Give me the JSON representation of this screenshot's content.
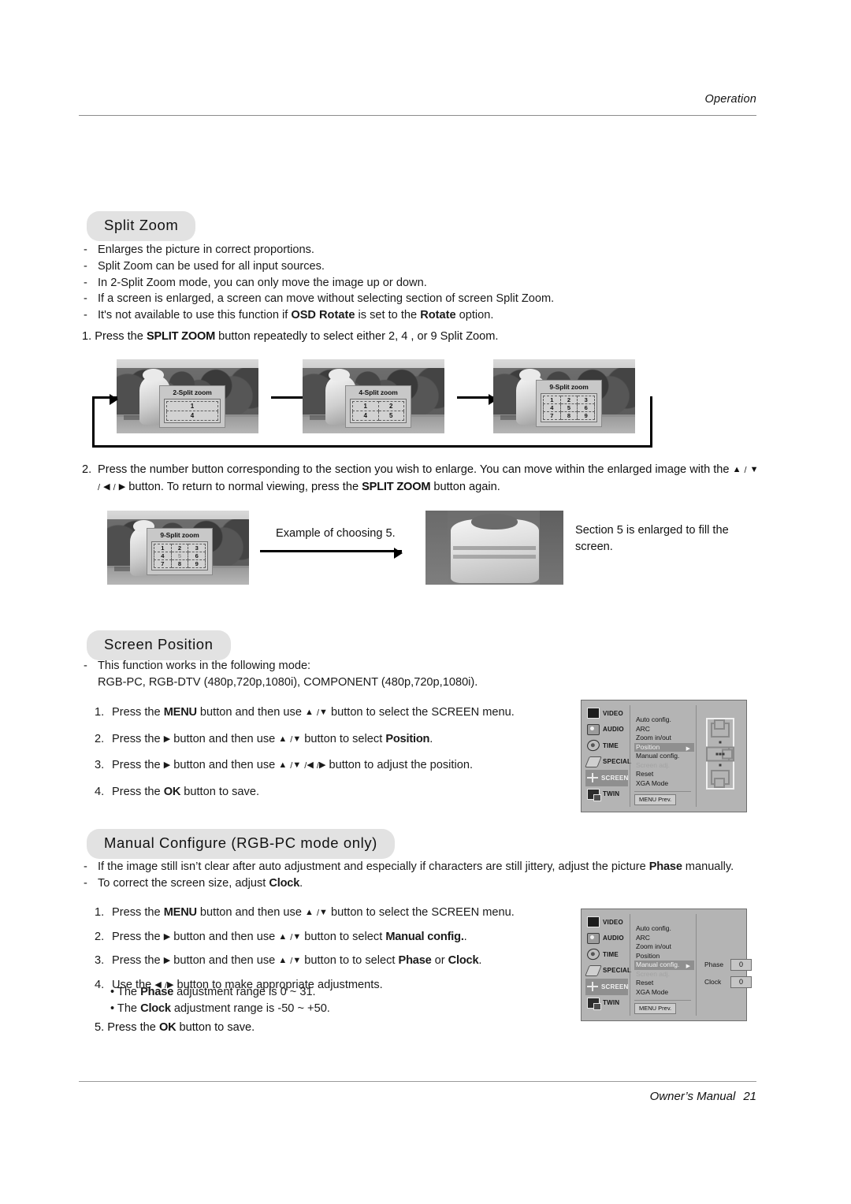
{
  "header": {
    "running_head": "Operation"
  },
  "footer": {
    "manual_label": "Owner’s Manual",
    "page_number": "21"
  },
  "split_zoom": {
    "title": "Split Zoom",
    "bullets": [
      "Enlarges the picture in correct proportions.",
      "Split Zoom can be used for all input sources.",
      "In 2-Split Zoom mode, you can only move the image up or down.",
      "If a screen is enlarged, a screen can move without selecting section of screen Split Zoom.",
      "It’s not available to use this function if OSD Rotate is set to the Rotate option."
    ],
    "step1_num": "1.",
    "step1_a": "Press the ",
    "step1_b": "SPLIT ZOOM",
    "step1_c": " button repeatedly to select either 2, 4 , or 9 Split Zoom.",
    "step2_num": "2.",
    "step2_a": "Press the number button corresponding to the section you wish to enlarge. You can move within the enlarged image with the ",
    "step2_b": " button. To return to normal viewing, press the ",
    "step2_c": "SPLIT ZOOM",
    "step2_d": " button again.",
    "osd_2split_title": "2-Split zoom",
    "osd_2split_cells": [
      "1",
      "4"
    ],
    "osd_4split_title": "4-Split zoom",
    "osd_4split_cells": [
      "1",
      "2",
      "4",
      "5"
    ],
    "osd_9split_title": "9-Split zoom",
    "osd_9split_cells": [
      "1",
      "2",
      "3",
      "4",
      "5",
      "6",
      "7",
      "8",
      "9"
    ],
    "example_caption": "Example of choosing 5.",
    "result_caption": "Section 5 is enlarged to fill the screen."
  },
  "screen_position": {
    "title": "Screen Position",
    "note_line1": "This function works in the following mode:",
    "note_line2": "RGB-PC, RGB-DTV (480p,720p,1080i), COMPONENT (480p,720p,1080i).",
    "steps": [
      {
        "num": "1.",
        "a": "Press the ",
        "b1": "MENU",
        "c": " button and then use ",
        "arrows": "▲ / ▼",
        "d": " button to select the SCREEN menu.",
        "b2": "",
        "e": ""
      },
      {
        "num": "2.",
        "a": "Press the ▶ button and then use ",
        "arrows": "▲ / ▼",
        "d": " button to select ",
        "b2": "Position",
        "e": "."
      },
      {
        "num": "3.",
        "a": "Press the ▶ button and then use ",
        "arrows": "▲ / ▼ / ◀ / ▶",
        "d": " button to adjust the position.",
        "b2": "",
        "e": ""
      },
      {
        "num": "4.",
        "a": "Press the ",
        "b1": "OK",
        "c": " button to save.",
        "arrows": "",
        "d": "",
        "b2": "",
        "e": ""
      }
    ]
  },
  "manual_configure": {
    "title": "Manual Configure (RGB-PC mode only)",
    "note1_a": "If the image still isn’t clear after auto adjustment and especially if characters are still jittery, adjust the picture ",
    "note1_b": "Phase",
    "note1_c": " manually.",
    "note2_a": "To correct the screen size, adjust ",
    "note2_b": "Clock",
    "note2_c": ".",
    "steps": [
      {
        "num": "1.",
        "a": "Press the ",
        "b1": "MENU",
        "c": " button and then use ",
        "arrows": "▲ / ▼",
        "d": " button to select the SCREEN menu."
      },
      {
        "num": "2.",
        "a": "Press the ▶ button and then use ",
        "arrows": "▲ / ▼",
        "d": " button to select ",
        "b2": "Manual config.",
        "e": "."
      },
      {
        "num": "3.",
        "a": "Press the ▶ button and then use ",
        "arrows": "▲ / ▼",
        "d": " button to to select ",
        "b2": "Phase",
        "e": " or ",
        "b3": "Clock",
        "f": "."
      },
      {
        "num": "4.",
        "a": "Use the ",
        "arrows": "◀ / ▶",
        "d": " button to make appropriate adjustments."
      },
      {
        "num": "5.",
        "a": "Press the ",
        "b1": "OK",
        "c": " button to save."
      }
    ],
    "bullet1_a": "• The ",
    "bullet1_b": "Phase",
    "bullet1_c": " adjustment range is 0 ~ 31.",
    "bullet2_a": "• The ",
    "bullet2_b": "Clock",
    "bullet2_c": " adjustment range is -50 ~ +50."
  },
  "osd": {
    "sidebar": [
      {
        "label": "VIDEO",
        "icon": "video-icon"
      },
      {
        "label": "AUDIO",
        "icon": "audio-icon"
      },
      {
        "label": "TIME",
        "icon": "time-icon"
      },
      {
        "label": "SPECIAL",
        "icon": "special-icon"
      },
      {
        "label": "SCREEN",
        "icon": "screen-icon"
      },
      {
        "label": "TWIN",
        "icon": "twin-icon"
      }
    ],
    "menu_items": [
      "Auto config.",
      "ARC",
      "Zoom in/out",
      "Position",
      "Manual config.",
      "Screen adj.",
      "Reset",
      "XGA Mode"
    ],
    "prev_label": "MENU  Prev.",
    "screen1_selected": "Position",
    "screen2_selected": "Manual config.",
    "phase_label": "Phase",
    "phase_value": "0",
    "clock_label": "Clock",
    "clock_value": "0"
  }
}
